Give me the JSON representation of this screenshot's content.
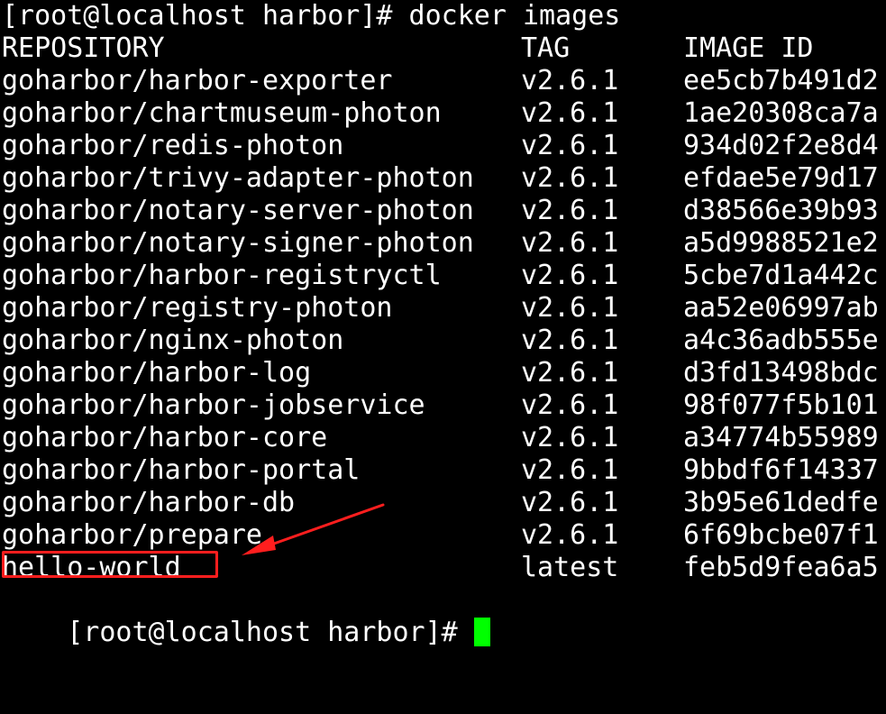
{
  "prompt_command": "[root@localhost harbor]# docker images",
  "headers": {
    "repository": "REPOSITORY",
    "tag": "TAG",
    "image_id": "IMAGE ID"
  },
  "rows": [
    {
      "repository": "goharbor/harbor-exporter",
      "tag": "v2.6.1",
      "image_id": "ee5cb7b491d2"
    },
    {
      "repository": "goharbor/chartmuseum-photon",
      "tag": "v2.6.1",
      "image_id": "1ae20308ca7a"
    },
    {
      "repository": "goharbor/redis-photon",
      "tag": "v2.6.1",
      "image_id": "934d02f2e8d4"
    },
    {
      "repository": "goharbor/trivy-adapter-photon",
      "tag": "v2.6.1",
      "image_id": "efdae5e79d17"
    },
    {
      "repository": "goharbor/notary-server-photon",
      "tag": "v2.6.1",
      "image_id": "d38566e39b93"
    },
    {
      "repository": "goharbor/notary-signer-photon",
      "tag": "v2.6.1",
      "image_id": "a5d9988521e2"
    },
    {
      "repository": "goharbor/harbor-registryctl",
      "tag": "v2.6.1",
      "image_id": "5cbe7d1a442c"
    },
    {
      "repository": "goharbor/registry-photon",
      "tag": "v2.6.1",
      "image_id": "aa52e06997ab"
    },
    {
      "repository": "goharbor/nginx-photon",
      "tag": "v2.6.1",
      "image_id": "a4c36adb555e"
    },
    {
      "repository": "goharbor/harbor-log",
      "tag": "v2.6.1",
      "image_id": "d3fd13498bdc"
    },
    {
      "repository": "goharbor/harbor-jobservice",
      "tag": "v2.6.1",
      "image_id": "98f077f5b101"
    },
    {
      "repository": "goharbor/harbor-core",
      "tag": "v2.6.1",
      "image_id": "a34774b55989"
    },
    {
      "repository": "goharbor/harbor-portal",
      "tag": "v2.6.1",
      "image_id": "9bbdf6f14337"
    },
    {
      "repository": "goharbor/harbor-db",
      "tag": "v2.6.1",
      "image_id": "3b95e61dedfe"
    },
    {
      "repository": "goharbor/prepare",
      "tag": "v2.6.1",
      "image_id": "6f69bcbe07f1"
    },
    {
      "repository": "hello-world",
      "tag": "latest",
      "image_id": "feb5d9fea6a5"
    }
  ],
  "prompt_final": "[root@localhost harbor]#",
  "colors": {
    "background": "#000000",
    "text": "#ffffff",
    "cursor": "#00ff00",
    "annotation": "#ff1e1e"
  }
}
